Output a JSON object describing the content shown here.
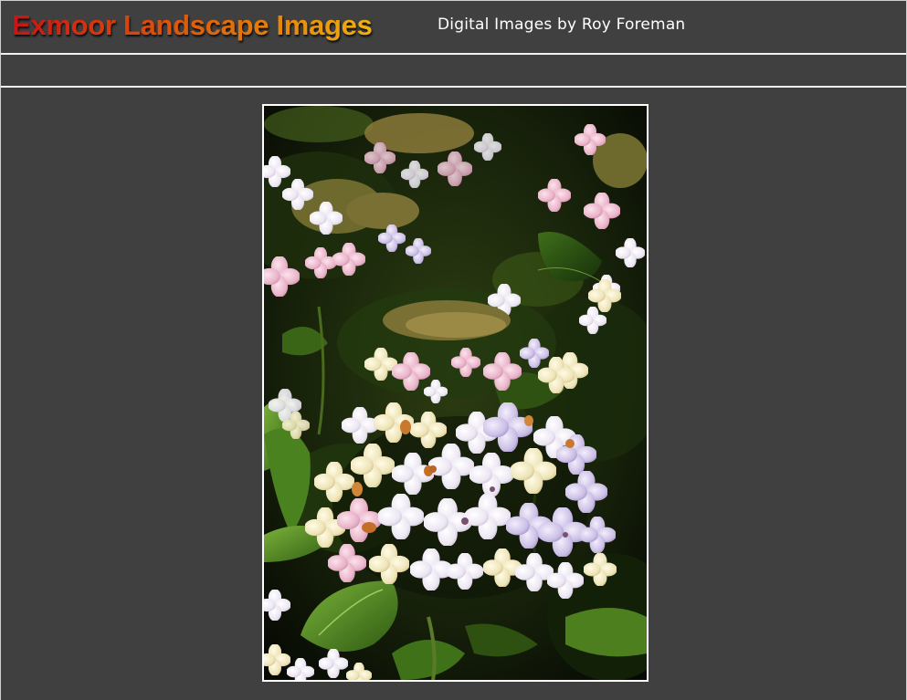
{
  "header": {
    "title": "Exmoor Landscape Images",
    "subtitle": "Digital Images by Roy Foreman"
  },
  "colors": {
    "background": "#404040",
    "rule": "#f2f2f2",
    "title_gradient_start": "#c81414",
    "title_gradient_end": "#f0b210",
    "subtitle": "#ffffff"
  },
  "photo": {
    "subject": "hydrangea-flowers"
  }
}
